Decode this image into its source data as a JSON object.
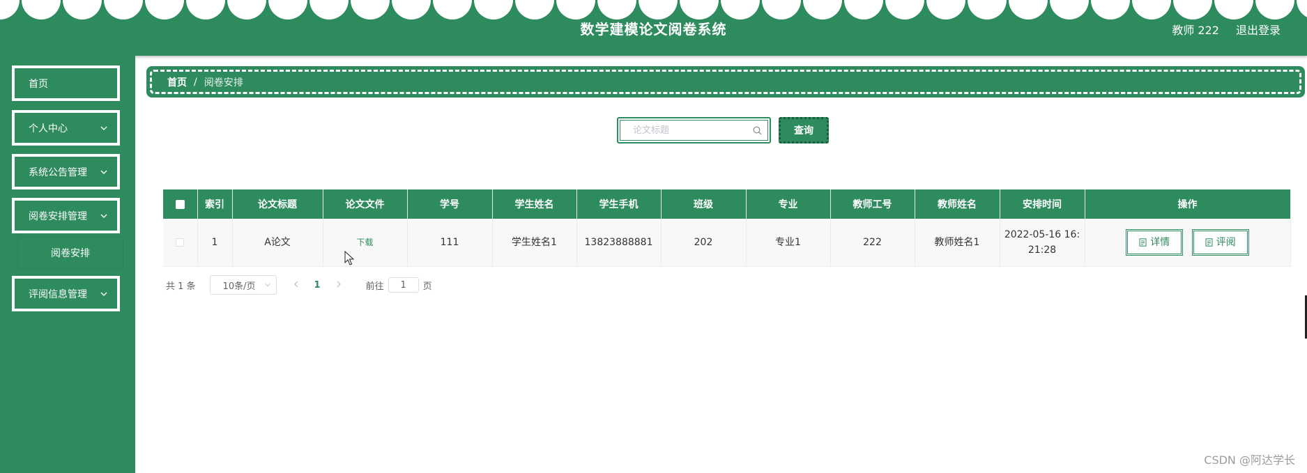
{
  "header": {
    "title": "数学建模论文阅卷系统",
    "user_label": "教师 222",
    "logout_label": "退出登录"
  },
  "sidebar": {
    "items": [
      {
        "label": "首页",
        "has_arrow": false
      },
      {
        "label": "个人中心",
        "has_arrow": true
      },
      {
        "label": "系统公告管理",
        "has_arrow": true
      },
      {
        "label": "阅卷安排管理",
        "has_arrow": true
      },
      {
        "label": "评阅信息管理",
        "has_arrow": true
      }
    ],
    "subitem": {
      "label": "阅卷安排"
    }
  },
  "breadcrumb": {
    "home": "首页",
    "separator": "/",
    "current": "阅卷安排"
  },
  "search": {
    "placeholder": "论文标题",
    "button_label": "查询"
  },
  "table": {
    "headers": [
      "索引",
      "论文标题",
      "论文文件",
      "学号",
      "学生姓名",
      "学生手机",
      "班级",
      "专业",
      "教师工号",
      "教师姓名",
      "安排时间",
      "操作"
    ],
    "rows": [
      {
        "index": "1",
        "title": "A论文",
        "file": "下载",
        "student_id": "111",
        "student_name": "学生姓名1",
        "phone": "13823888881",
        "class": "202",
        "major": "专业1",
        "teacher_id": "222",
        "teacher_name": "教师姓名1",
        "time_line1": "2022-05-16 16:",
        "time_line2": "21:28",
        "detail_label": "详情",
        "review_label": "评阅"
      }
    ]
  },
  "pagination": {
    "total": "共 1 条",
    "page_size": "10条/页",
    "current_page": "1",
    "goto_label": "前往",
    "goto_value": "1",
    "page_suffix": "页"
  },
  "watermark": "CSDN @阿达学长",
  "colors": {
    "primary": "#2e8b5e",
    "white": "#ffffff",
    "row_bg": "#f8f8f8"
  },
  "icons": [
    "chevron-down-icon",
    "search-icon",
    "document-icon",
    "cursor-icon"
  ]
}
